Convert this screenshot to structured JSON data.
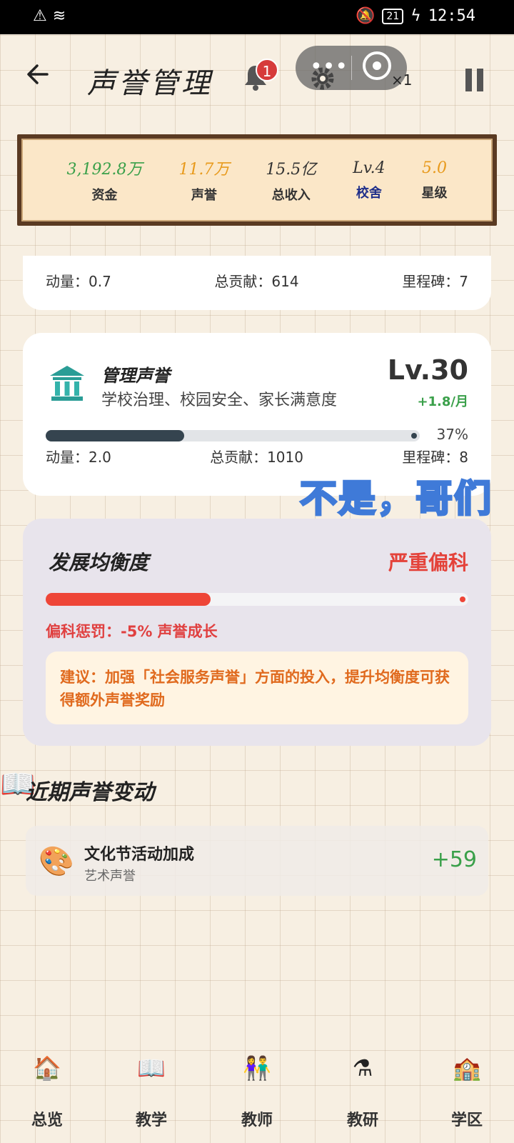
{
  "status": {
    "time": "12:54",
    "battery": "21"
  },
  "header": {
    "title": "声誉管理",
    "notifications": "1",
    "speed": "×1"
  },
  "stats": [
    {
      "value": "3,192.8万",
      "label": "资金",
      "color": "#3aa04a"
    },
    {
      "value": "11.7万",
      "label": "声誉",
      "color": "#e89a1c"
    },
    {
      "value": "15.5亿",
      "label": "总收入",
      "color": "#333333"
    },
    {
      "value": "Lv.4",
      "label": "校舍",
      "color": "#333333",
      "label_color": "#1f2f8a"
    },
    {
      "value": "5.0",
      "label": "星级",
      "color": "#e89a1c"
    }
  ],
  "card_a": {
    "momentum": "动量：0.7",
    "contribution": "总贡献：614",
    "milestone": "里程碑：7"
  },
  "card_b": {
    "title": "管理声誉",
    "subtitle": "学校治理、校园安全、家长满意度",
    "level": "Lv.30",
    "rate": "+1.8/月",
    "progress": 0.37,
    "progress_label": "37%",
    "momentum": "动量：2.0",
    "contribution": "总贡献：1010",
    "milestone": "里程碑：8",
    "bar_color": "#35444f"
  },
  "watermark": "不是，哥们",
  "balance": {
    "title": "发展均衡度",
    "status": "严重偏科",
    "progress": 0.39,
    "penalty": "偏科惩罚：-5% 声誉成长",
    "tip": "建议：加强「社会服务声誉」方面的投入，提升均衡度可获得额外声誉奖励",
    "bar_color": "#ee4537"
  },
  "recent": {
    "title": "近期声誉变动",
    "items": [
      {
        "name": "文化节活动加成",
        "category": "艺术声誉",
        "value": "+59",
        "icon": "palette-icon"
      }
    ]
  },
  "nav": [
    {
      "label": "总览",
      "icon": "house-icon"
    },
    {
      "label": "教学",
      "icon": "book-icon"
    },
    {
      "label": "教师",
      "icon": "teachers-icon"
    },
    {
      "label": "教研",
      "icon": "flask-icon"
    },
    {
      "label": "学区",
      "icon": "school-building-icon"
    }
  ]
}
